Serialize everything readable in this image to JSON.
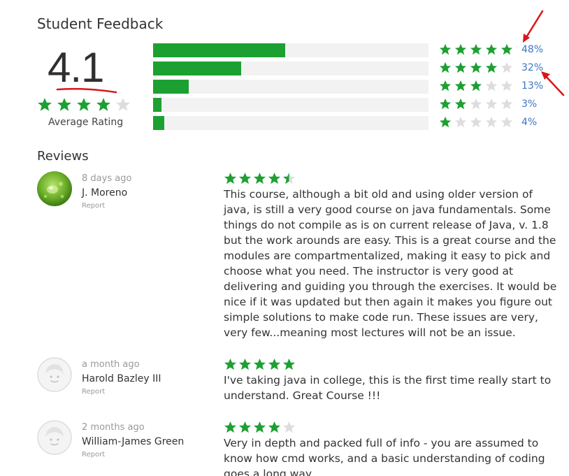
{
  "header": {
    "title": "Student Feedback"
  },
  "summary": {
    "average": "4.1",
    "average_value": 4.1,
    "average_stars": 4,
    "label": "Average Rating"
  },
  "breakdown": [
    {
      "stars": 5,
      "percent_label": "48%",
      "percent": 48
    },
    {
      "stars": 4,
      "percent_label": "32%",
      "percent": 32
    },
    {
      "stars": 3,
      "percent_label": "13%",
      "percent": 13
    },
    {
      "stars": 2,
      "percent_label": "3%",
      "percent": 3
    },
    {
      "stars": 1,
      "percent_label": "4%",
      "percent": 4
    }
  ],
  "reviews_title": "Reviews",
  "reviews": [
    {
      "time": "8 days ago",
      "name": "J. Moreno",
      "report": "Report",
      "rating": 4.5,
      "avatar": "green-water-drop-avatar",
      "text": "This course, although a bit old and using older version of java, is still a very good course on java fundamentals. Some things do not compile as is on current release of Java, v. 1.8 but the work arounds are easy. This is a great course and the modules are compartmentalized, making it easy to pick and choose what you need. The instructor is very good at delivering and guiding you through the exercises. It would be nice if it was updated but then again it makes you figure out simple solutions to make code run. These issues are very, very few...meaning most lectures will not be an issue."
    },
    {
      "time": "a month ago",
      "name": "Harold Bazley III",
      "report": "Report",
      "rating": 5,
      "avatar": "default-user-avatar",
      "text": "I've taking java in college, this is the first time really start to understand. Great Course !!!"
    },
    {
      "time": "2 months ago",
      "name": "William-James Green",
      "report": "Report",
      "rating": 4,
      "avatar": "default-user-avatar",
      "text": "Very in depth and packed full of info - you are assumed to know how cmd works, and a basic understanding of coding goes a long way."
    }
  ],
  "colors": {
    "star_filled": "#1da032",
    "star_empty": "#dddddd",
    "bar_fill": "#1da032",
    "bar_track": "#f2f2f2",
    "link": "#3b75c4",
    "annotation": "#d9161b"
  }
}
